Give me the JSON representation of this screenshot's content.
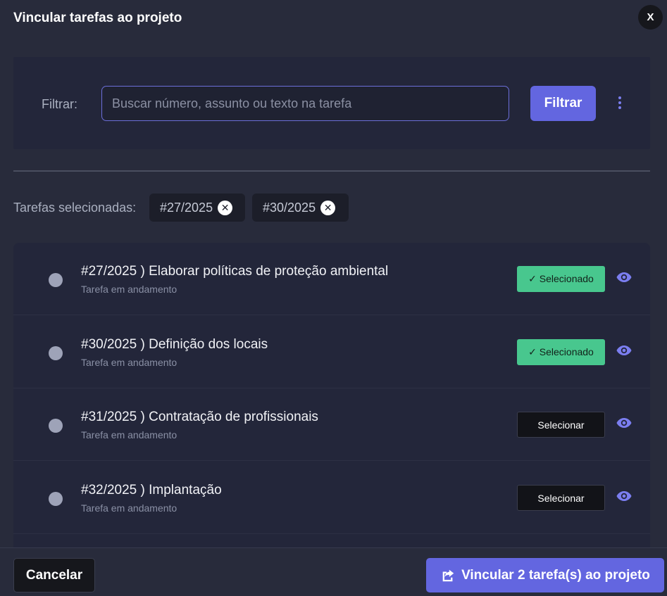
{
  "modal": {
    "title": "Vincular tarefas ao projeto",
    "close_label": "X"
  },
  "filter": {
    "label": "Filtrar:",
    "placeholder": "Buscar número, assunto ou texto na tarefa",
    "value": "",
    "button_label": "Filtrar",
    "more_icon": "more-vertical-icon"
  },
  "selection": {
    "label": "Tarefas selecionadas:",
    "chips": [
      "#27/2025",
      "#30/2025"
    ],
    "chip_close_icon": "close-x-icon"
  },
  "tasks": [
    {
      "title": "#27/2025 ) Elaborar políticas de proteção ambiental",
      "status": "Tarefa em andamento",
      "button": "✓ Selecionado",
      "selected": true
    },
    {
      "title": "#30/2025 ) Definição dos locais",
      "status": "Tarefa em andamento",
      "button": "✓ Selecionado",
      "selected": true
    },
    {
      "title": "#31/2025 ) Contratação de profissionais",
      "status": "Tarefa em andamento",
      "button": "Selecionar",
      "selected": false
    },
    {
      "title": "#32/2025 ) Implantação",
      "status": "Tarefa em andamento",
      "button": "Selecionar",
      "selected": false
    }
  ],
  "footer": {
    "cancel_label": "Cancelar",
    "link_label": "Vincular 2 tarefa(s) ao projeto",
    "link_icon": "share-icon"
  },
  "colors": {
    "background": "#282b3b",
    "panel": "#23263a",
    "accent": "#6366e0",
    "selected_green": "#48c78e"
  }
}
